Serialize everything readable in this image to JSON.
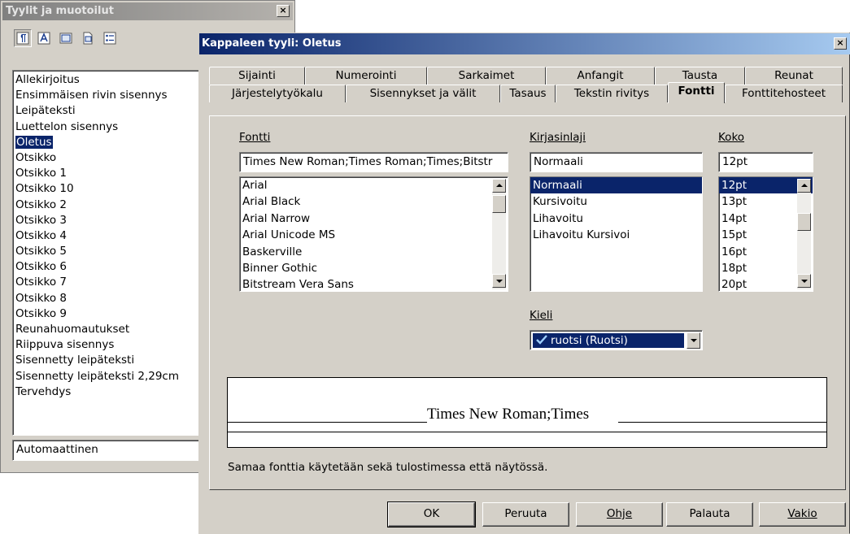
{
  "stylist": {
    "title": "Tyylit ja muotoilut",
    "close": "×",
    "toolbar_icons": [
      "paragraph-styles-icon",
      "character-styles-icon",
      "frame-styles-icon",
      "page-styles-icon",
      "list-styles-icon"
    ],
    "styles": [
      "Allekirjoitus",
      "Ensimmäisen rivin sisennys",
      "Leipäteksti",
      "Luettelon sisennys",
      "Oletus",
      "Otsikko",
      "Otsikko 1",
      "Otsikko 10",
      "Otsikko 2",
      "Otsikko 3",
      "Otsikko 4",
      "Otsikko 5",
      "Otsikko 6",
      "Otsikko 7",
      "Otsikko 8",
      "Otsikko 9",
      "Reunahuomautukset",
      "Riippuva sisennys",
      "Sisennetty leipäteksti",
      "Sisennetty leipäteksti 2,29cm",
      "Tervehdys"
    ],
    "selected_style": "Oletus",
    "filter_value": "Automaattinen"
  },
  "dialog": {
    "title": "Kappaleen tyyli: Oletus",
    "close": "×",
    "tabs_row1": [
      "Sijainti",
      "Numerointi",
      "Sarkaimet",
      "Anfangit",
      "Tausta",
      "Reunat"
    ],
    "tabs_row2": [
      "Järjestelytyökalu",
      "Sisennykset ja välit",
      "Tasaus",
      "Tekstin rivitys",
      "Fontti",
      "Fonttitehosteet"
    ],
    "active_tab": "Fontti",
    "font": {
      "label": "Fontti",
      "value": "Times New Roman;Times Roman;Times;Bitstr",
      "list": [
        "Arial",
        "Arial Black",
        "Arial Narrow",
        "Arial Unicode MS",
        "Baskerville",
        "Binner Gothic",
        "Bitstream Vera Sans"
      ]
    },
    "typeface": {
      "label": "Kirjasinlaji",
      "value": "Normaali",
      "list": [
        "Normaali",
        "Kursivoitu",
        "Lihavoitu",
        "Lihavoitu Kursivoi"
      ],
      "selected": "Normaali"
    },
    "size": {
      "label": "Koko",
      "value": "12pt",
      "list": [
        "12pt",
        "13pt",
        "14pt",
        "15pt",
        "16pt",
        "18pt",
        "20pt"
      ],
      "selected": "12pt"
    },
    "language": {
      "label": "Kieli",
      "value": "ruotsi (Ruotsi)"
    },
    "preview_text": "Times New Roman;Times",
    "info_text": "Samaa fonttia käytetään sekä tulostimessa että näytössä.",
    "buttons": {
      "ok": "OK",
      "cancel": "Peruuta",
      "help": "Ohje",
      "reset": "Palauta",
      "standard": "Vakio"
    }
  },
  "colors": {
    "face": "#d4d0c8",
    "title_active": "#0a246a",
    "title_inactive": "#808080",
    "selection": "#0a246a"
  }
}
